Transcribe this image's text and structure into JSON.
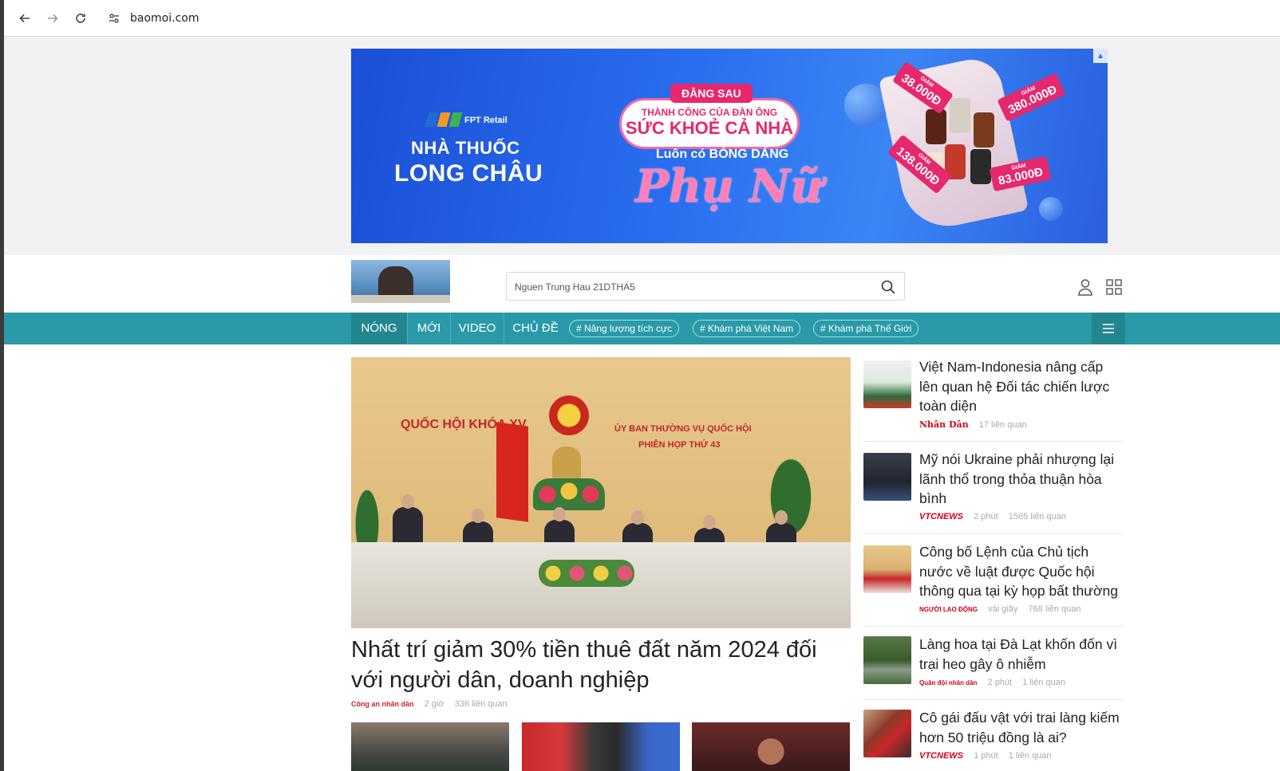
{
  "browser": {
    "url": "baomoi.com"
  },
  "ad": {
    "retail_label": "FPT Retail",
    "brand_line1": "NHÀ THUỐC",
    "brand_line2": "LONG CHÂU",
    "tag": "ĐẰNG SAU",
    "bubble_line1": "THÀNH CÔNG CỦA ĐÀN ÔNG",
    "bubble_line2": "SỨC KHOẺ CẢ NHÀ",
    "sub": "Luôn có BÓNG DÁNG",
    "script": "Phụ Nữ",
    "prices": [
      {
        "label": "GIẢM",
        "amount": "38.000Đ"
      },
      {
        "label": "GIẢM",
        "amount": "380.000Đ"
      },
      {
        "label": "GIẢM",
        "amount": "138.000Đ"
      },
      {
        "label": "GIẢM",
        "amount": "83.000Đ"
      }
    ]
  },
  "header": {
    "search_value": "Nguen Trung Hau 21DTHA5"
  },
  "nav": {
    "items": [
      "NÓNG",
      "MỚI",
      "VIDEO",
      "CHỦ ĐỀ"
    ],
    "chips": [
      "# Năng lượng tích cực",
      "# Khám phá Việt Nam",
      "# Khám phá Thế Giới"
    ]
  },
  "featured": {
    "image_text1": "QUỐC HỘI KHÓA XV",
    "image_text2": "ỦY BAN THƯỜNG VỤ QUỐC HỘI",
    "image_text3": "PHIÊN HỌP THỨ 43",
    "title": "Nhất trí giảm 30% tiền thuê đất năm 2024 đối với người dân, doanh nghiệp",
    "source": "Công an nhân dân",
    "time": "2 giờ",
    "related": "336 liên quan"
  },
  "side_articles": [
    {
      "title": "Việt Nam-Indonesia nâng cấp lên quan hệ Đối tác chiến lược toàn diện",
      "source": "Nhân Dân",
      "source_color": "#d0021b",
      "time": "",
      "related": "17 liên quan"
    },
    {
      "title": "Mỹ nói Ukraine phải nhượng lại lãnh thổ trong thỏa thuận hòa bình",
      "source": "VTCNEWS",
      "source_color": "#d0021b",
      "time": "2 phút",
      "related": "1565 liên quan"
    },
    {
      "title": "Công bố Lệnh của Chủ tịch nước về luật được Quốc hội thông qua tại kỳ họp bất thường",
      "source": "NGƯỜI LAO ĐỘNG",
      "source_color": "#d0021b",
      "time": "vài giây",
      "related": "768 liên quan"
    },
    {
      "title": "Làng hoa tại Đà Lạt khốn đốn vì trại heo gây ô nhiễm",
      "source": "Quân đội nhân dân",
      "source_color": "#d0021b",
      "time": "2 phút",
      "related": "1 liên quan"
    },
    {
      "title": "Cô gái đấu vật với trai làng kiếm hơn 50 triệu đồng là ai?",
      "source": "VTCNEWS",
      "source_color": "#d0021b",
      "time": "1 phút",
      "related": "1 liên quan"
    }
  ],
  "colors": {
    "nav_bg": "#2a9aa8",
    "nav_active": "#23868f",
    "ad_pink": "#e6286e",
    "source_red": "#d0021b"
  }
}
